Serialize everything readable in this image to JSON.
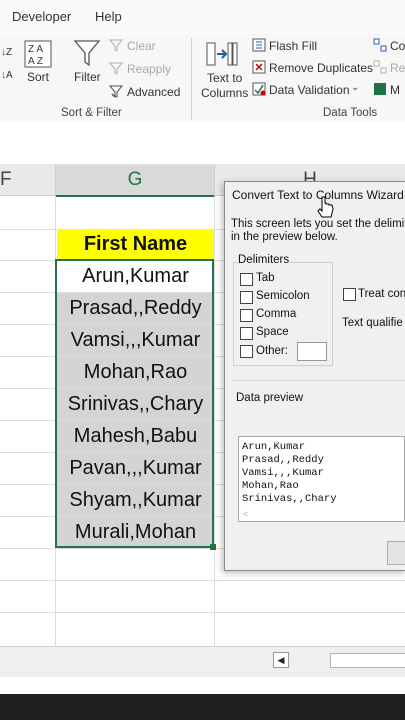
{
  "ribbon": {
    "tabs": [
      "Developer",
      "Help"
    ],
    "sort_filter": {
      "sort_label": "Sort",
      "filter_label": "Filter",
      "clear_label": "Clear",
      "reapply_label": "Reapply",
      "advanced_label": "Advanced",
      "group_label": "Sort & Filter"
    },
    "data_tools": {
      "text_to_columns_line1": "Text to",
      "text_to_columns_line2": "Columns",
      "flash_fill_label": "Flash Fill",
      "remove_duplicates_label": "Remove Duplicates",
      "data_validation_label": "Data Validation",
      "group_label": "Data Tools",
      "cut_co": "Co",
      "cut_re": "Re",
      "cut_ma": "M"
    }
  },
  "sheet": {
    "columns": [
      "F",
      "G",
      "H"
    ],
    "header": "First Name",
    "rows": [
      "Arun,Kumar",
      "Prasad,,Reddy",
      "Vamsi,,,Kumar",
      "Mohan,Rao",
      "Srinivas,,Chary",
      "Mahesh,Babu",
      "Pavan,,,Kumar",
      "Shyam,,Kumar",
      "Murali,Mohan"
    ]
  },
  "dialog": {
    "title": "Convert Text to Columns Wizard - ",
    "intro_line1": "This screen lets you set the delimite",
    "intro_line2": "in the preview below.",
    "delimiters_label": "Delimiters",
    "options": {
      "tab": "Tab",
      "semicolon": "Semicolon",
      "comma": "Comma",
      "space": "Space",
      "other": "Other:"
    },
    "treat_label": "Treat con",
    "qualifier_label": "Text qualifie",
    "preview_label": "Data preview",
    "preview_lines": [
      "Arun,Kumar",
      "Prasad,,Reddy",
      "Vamsi,,,Kumar",
      "Mohan,Rao",
      "Srinivas,,Chary"
    ]
  },
  "colors": {
    "header_fill": "#ffff00",
    "row_fill": "#d4d4d4",
    "selection_border": "#217346"
  }
}
